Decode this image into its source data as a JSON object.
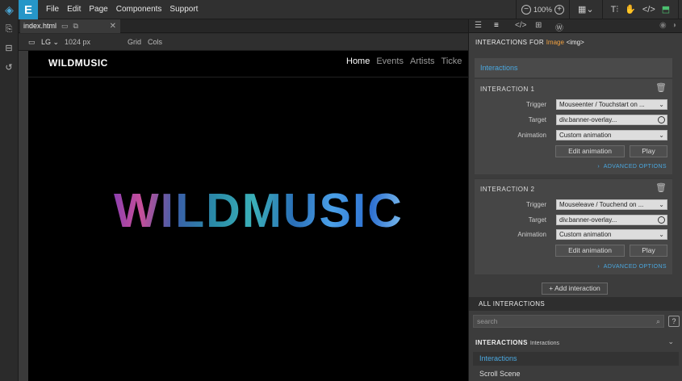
{
  "app": {
    "logo_letter": "E"
  },
  "menu": [
    "File",
    "Edit",
    "Page",
    "Components",
    "Support"
  ],
  "toolbar": {
    "zoom": "100%"
  },
  "tab": {
    "filename": "index.html"
  },
  "viewport": {
    "size_label": "LG",
    "width": "1024 px",
    "grid": "Grid",
    "cols": "Cols"
  },
  "site": {
    "brand": "WILDMUSIC",
    "nav": [
      "Home",
      "Events",
      "Artists",
      "Ticke"
    ],
    "hero": "WILDMUSIC"
  },
  "panel": {
    "title_prefix": "INTERACTIONS FOR",
    "element": "Image",
    "tag": "<img>",
    "section": "Interactions",
    "interactions": [
      {
        "header": "INTERACTION 1",
        "trigger_label": "Trigger",
        "trigger": "Mouseenter / Touchstart on ...",
        "target_label": "Target",
        "target": "div.banner-overlay...",
        "animation_label": "Animation",
        "animation": "Custom animation",
        "edit": "Edit animation",
        "play": "Play",
        "advanced": "ADVANCED OPTIONS"
      },
      {
        "header": "INTERACTION 2",
        "trigger_label": "Trigger",
        "trigger": "Mouseleave / Touchend on ...",
        "target_label": "Target",
        "target": "div.banner-overlay...",
        "animation_label": "Animation",
        "animation": "Custom animation",
        "edit": "Edit animation",
        "play": "Play",
        "advanced": "ADVANCED OPTIONS"
      }
    ],
    "add_interaction": "+ Add interaction",
    "all_interactions": "ALL INTERACTIONS",
    "search_placeholder": "search",
    "list_header": "INTERACTIONS",
    "list_sub": "Interactions",
    "list_items": [
      "Interactions",
      "Scroll Scene"
    ]
  },
  "colors": {
    "accent": "#2696c8",
    "link": "#4aa8e0",
    "element": "#f0a040"
  }
}
